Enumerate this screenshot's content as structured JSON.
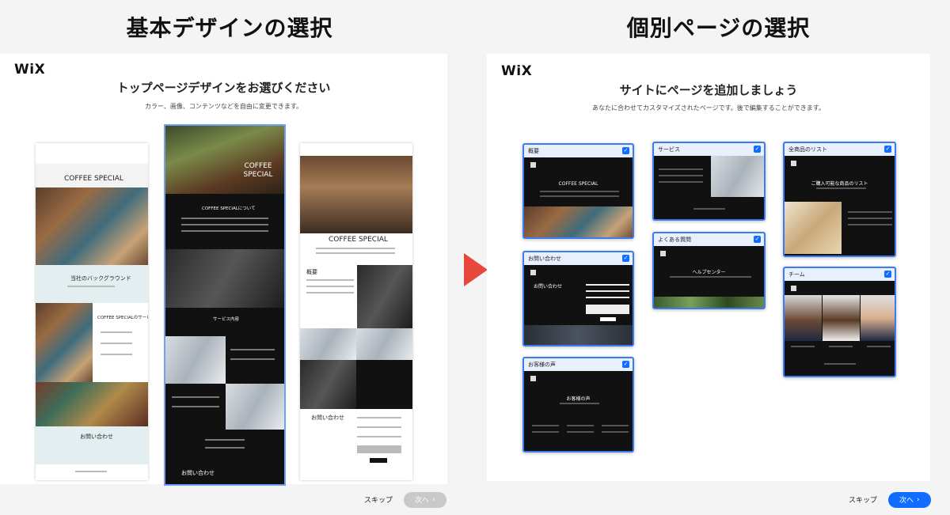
{
  "headers": {
    "left": "基本デザインの選択",
    "right": "個別ページの選択"
  },
  "left_panel": {
    "logo": "WiX",
    "title": "トップページデザインをお選びください",
    "subtitle": "カラー、画像、コンテンツなどを自由に変更できます。",
    "templates": [
      {
        "name": "template-1",
        "brand": "COFFEE SPECIAL",
        "section1": "当社のバックグラウンド",
        "section2": "COFFEE SPECIALのサービス",
        "section3": "お問い合わせ"
      },
      {
        "name": "template-2",
        "brand": "COFFEE SPECIAL",
        "section1": "COFFEE SPECIALについて",
        "section2": "サービス内容",
        "section3": "お問い合わせ"
      },
      {
        "name": "template-3",
        "brand": "COFFEE SPECIAL",
        "section1": "概要",
        "section3": "お問い合わせ"
      }
    ],
    "skip_label": "スキップ",
    "next_label": "次へ",
    "next_arrow": "›"
  },
  "right_panel": {
    "logo": "WiX",
    "title": "サイトにページを追加しましょう",
    "subtitle": "あなたに合わせてカスタマイズされたページです。後で編集することができます。",
    "pages": [
      {
        "label": "概要",
        "body_title": "COFFEE SPECIAL",
        "checked": true
      },
      {
        "label": "お問い合わせ",
        "body_title": "お問い合わせ",
        "checked": true
      },
      {
        "label": "お客様の声",
        "body_title": "お客様の声",
        "checked": true
      },
      {
        "label": "サービス",
        "checked": true
      },
      {
        "label": "よくある質問",
        "body_title": "ヘルプセンター",
        "checked": true
      },
      {
        "label": "全商品のリスト",
        "body_title": "ご購入可能な商品のリスト",
        "checked": true
      },
      {
        "label": "チーム",
        "checked": true
      }
    ],
    "check_glyph": "✓",
    "skip_label": "スキップ",
    "next_label": "次へ",
    "next_arrow": "›"
  },
  "colors": {
    "arrow": "#e6483e",
    "accent": "#116dff",
    "selected_outline": "#6fa0f0"
  }
}
